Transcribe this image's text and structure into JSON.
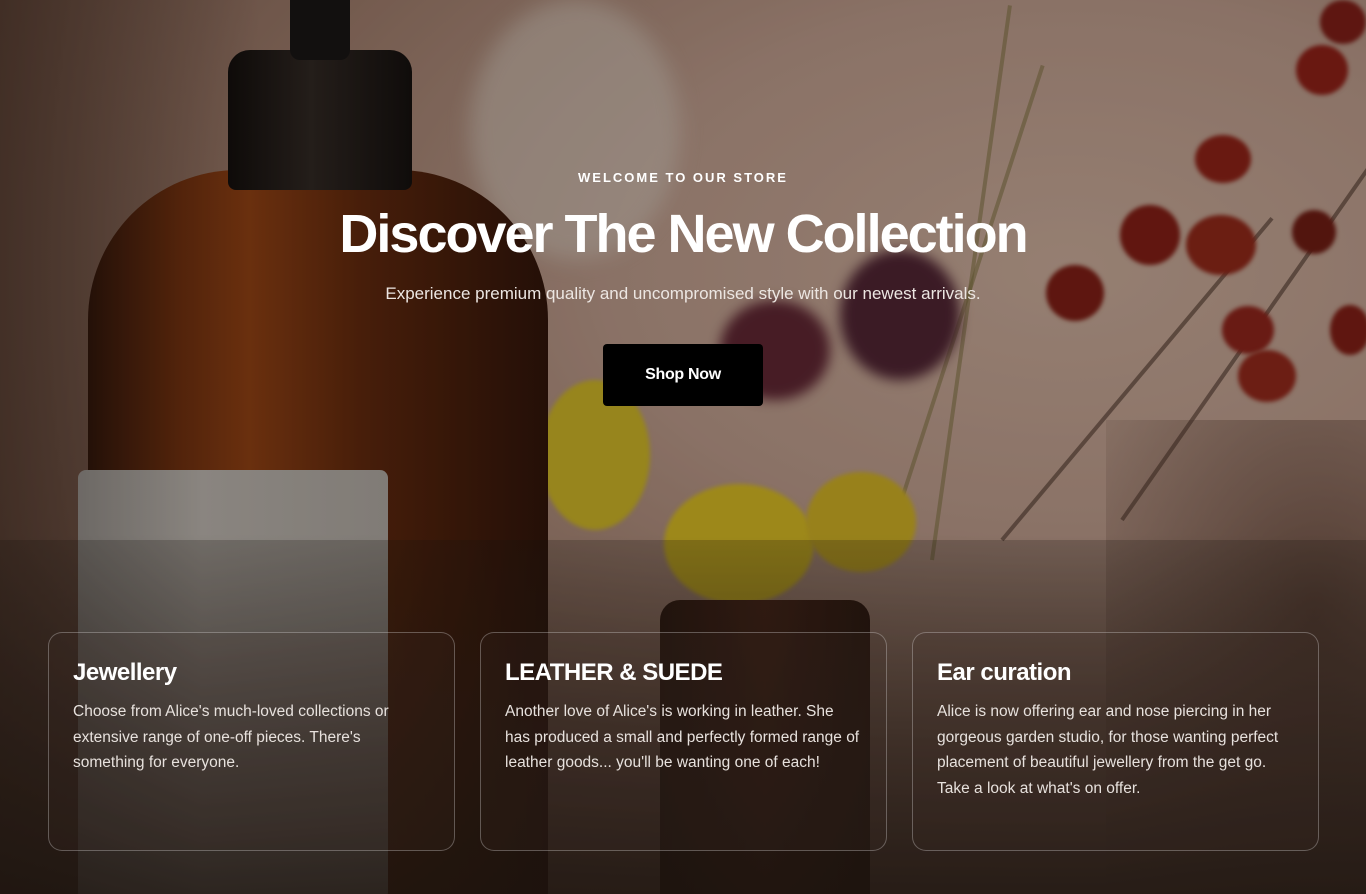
{
  "hero": {
    "eyebrow": "WELCOME TO OUR STORE",
    "title": "Discover The New Collection",
    "subtitle": "Experience premium quality and uncompromised style with our newest arrivals.",
    "cta_label": "Shop Now",
    "cta_color": "#000000"
  },
  "cards": [
    {
      "title": "Jewellery",
      "text": "Choose from Alice's much-loved collections or extensive range of one-off pieces. There's something for everyone."
    },
    {
      "title": "LEATHER & SUEDE",
      "text": "Another love of Alice's is working in leather. She has produced a small and perfectly formed range of leather goods... you'll be wanting one of each!"
    },
    {
      "title": "Ear curation",
      "text": "Alice is now offering ear and nose piercing in her gorgeous garden studio, for those wanting perfect placement of beautiful jewellery from the get go. Take a look at what's on offer."
    }
  ]
}
